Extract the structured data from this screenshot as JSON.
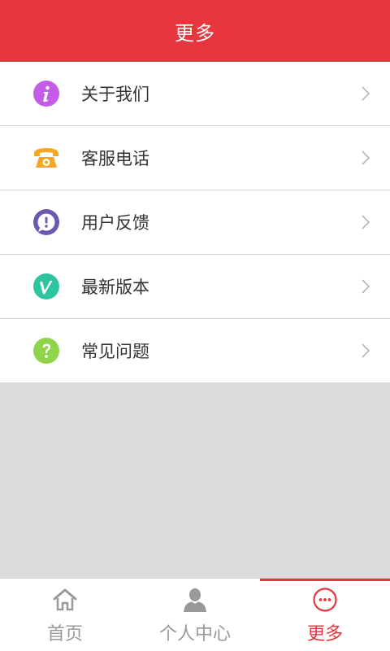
{
  "header": {
    "title": "更多"
  },
  "menu": {
    "items": [
      {
        "label": "关于我们",
        "icon": "info-icon",
        "color": "#c35de8"
      },
      {
        "label": "客服电话",
        "icon": "telephone-icon",
        "color": "#f5a623"
      },
      {
        "label": "用户反馈",
        "icon": "feedback-icon",
        "color": "#6b58b0"
      },
      {
        "label": "最新版本",
        "icon": "version-icon",
        "color": "#2ec4a0"
      },
      {
        "label": "常见问题",
        "icon": "question-icon",
        "color": "#8fd44a"
      }
    ]
  },
  "tabbar": {
    "tabs": [
      {
        "label": "首页",
        "icon": "home-icon",
        "active": false
      },
      {
        "label": "个人中心",
        "icon": "person-icon",
        "active": false
      },
      {
        "label": "更多",
        "icon": "more-icon",
        "active": true
      }
    ]
  },
  "colors": {
    "accent": "#e8363f",
    "inactive": "#999999"
  }
}
